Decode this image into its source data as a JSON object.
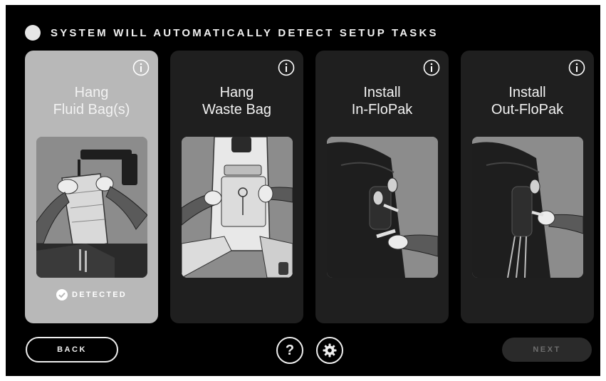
{
  "header": {
    "title": "SYSTEM WILL AUTOMATICALLY DETECT SETUP TASKS"
  },
  "cards": [
    {
      "title_line1": "Hang",
      "title_line2": "Fluid Bag(s)",
      "status": "DETECTED",
      "detected": true,
      "illustration": "hands-hanging-fluid-bag"
    },
    {
      "title_line1": "Hang",
      "title_line2": "Waste Bag",
      "status": "",
      "detected": false,
      "illustration": "hands-hanging-waste-bag"
    },
    {
      "title_line1": "Install",
      "title_line2": "In-FloPak",
      "status": "",
      "detected": false,
      "illustration": "hand-installing-in-flopak"
    },
    {
      "title_line1": "Install",
      "title_line2": "Out-FloPak",
      "status": "",
      "detected": false,
      "illustration": "hand-installing-out-flopak"
    }
  ],
  "footer": {
    "back_label": "BACK",
    "help_label": "?",
    "settings_icon": "gear-icon",
    "next_label": "NEXT"
  },
  "icons": {
    "info": "info-icon",
    "check": "check-circle-icon",
    "status": "status-dot"
  },
  "colors": {
    "background": "#000000",
    "card": "#1f1f1f",
    "card_detected": "#b8b8b8",
    "next_disabled": "#2a2a2a"
  }
}
